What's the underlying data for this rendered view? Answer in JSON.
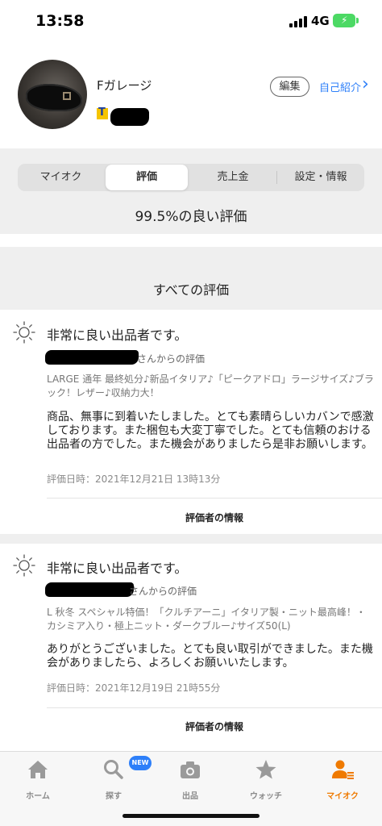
{
  "status_bar": {
    "time": "13:58",
    "network": "4G"
  },
  "profile": {
    "name": "Fガレージ",
    "edit_label": "編集",
    "intro_label": "自己紹介"
  },
  "tabs": [
    {
      "label": "マイオク"
    },
    {
      "label": "評価"
    },
    {
      "label": "売上金"
    },
    {
      "label": "設定・情報"
    }
  ],
  "rating_summary": "99.5%の良い評価",
  "all_ratings_title": "すべての評価",
  "reviews": [
    {
      "title": "非常に良い出品者です。",
      "from_suffix": "さんからの評価",
      "item": "LARGE 通年 最終処分♪新品イタリア♪「ピークアドロ」ラージサイズ♪ブラック！レザー♪収納力大！",
      "comment": "商品、無事に到着いたしました。とても素晴らしいカバンで感激しております。また梱包も大変丁寧でした。とても信頼のおける出品者の方でした。また機会がありましたら是非お願いします。",
      "date": "評価日時：2021年12月21日 13時13分",
      "rater_label": "評価者の情報"
    },
    {
      "title": "非常に良い出品者です。",
      "from_suffix": "さんからの評価",
      "item": "L 秋冬 スペシャル特価！「クルチアーニ」イタリア製・ニット最高峰！・カシミア入り・極上ニット・ダークブルー♪サイズ50(L)",
      "comment": "ありがとうございました。とても良い取引ができました。また機会がありましたら、よろしくお願いいたします。",
      "date": "評価日時：2021年12月19日 21時55分",
      "rater_label": "評価者の情報"
    }
  ],
  "bottom_nav": [
    {
      "label": "ホーム",
      "icon": "home-icon"
    },
    {
      "label": "探す",
      "icon": "search-icon",
      "badge": "NEW"
    },
    {
      "label": "出品",
      "icon": "camera-icon"
    },
    {
      "label": "ウォッチ",
      "icon": "star-icon"
    },
    {
      "label": "マイオク",
      "icon": "user-menu-icon"
    }
  ],
  "colors": {
    "accent": "#ef7a00",
    "link": "#2d7ff9",
    "section_bg": "#efefef",
    "battery": "#4cd964"
  }
}
